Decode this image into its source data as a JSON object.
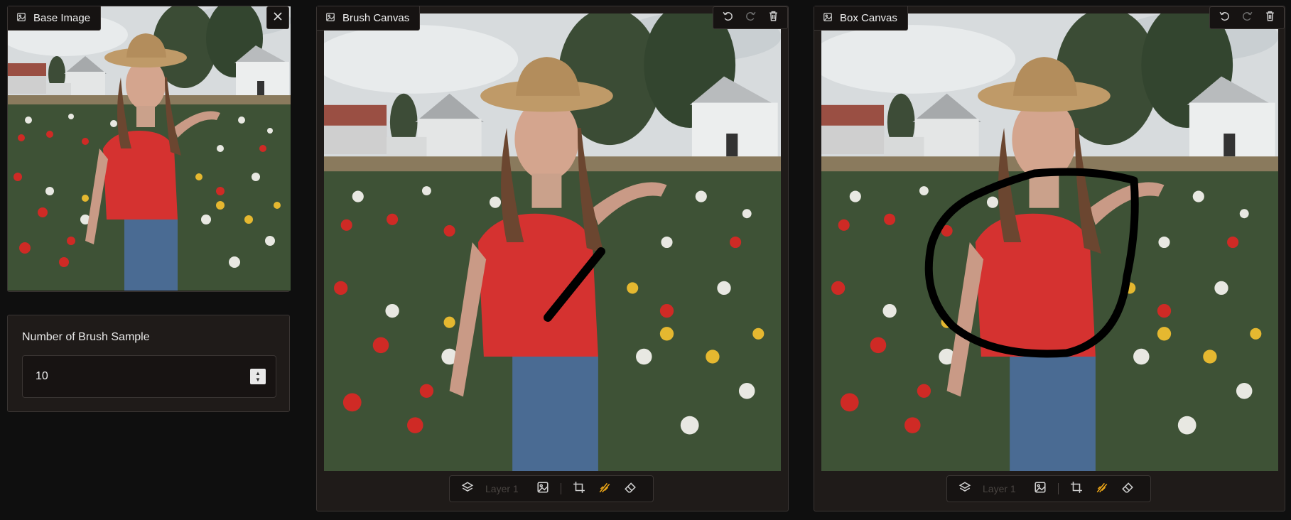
{
  "base_panel": {
    "title": "Base Image"
  },
  "brush_panel": {
    "title": "Brush Canvas",
    "layer_label": "Layer 1"
  },
  "box_panel": {
    "title": "Box Canvas",
    "layer_label": "Layer 1"
  },
  "brush_samples": {
    "label": "Number of Brush Sample",
    "value": "10"
  },
  "colors": {
    "accent": "#e8a317",
    "panel_bg": "#1f1b19",
    "page_bg": "#0f0f0f",
    "stroke": "#000000"
  },
  "icons": [
    "image-icon",
    "close-icon",
    "undo-icon",
    "redo-icon",
    "trash-icon",
    "layers-icon",
    "crop-icon",
    "brush-icon",
    "eraser-icon"
  ]
}
